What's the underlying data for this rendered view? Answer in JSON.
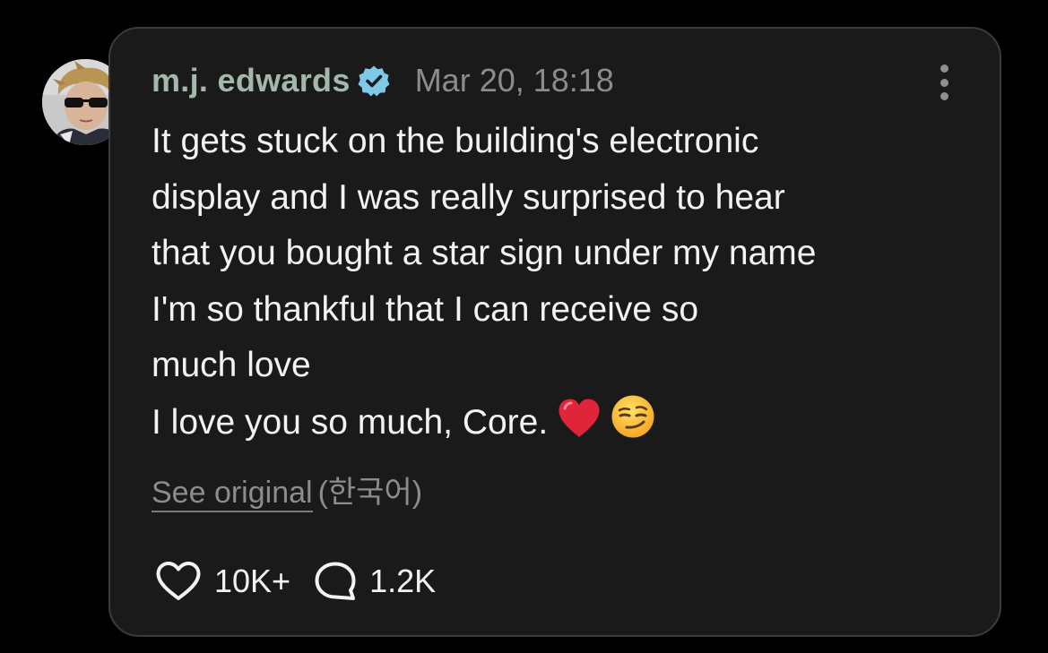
{
  "post": {
    "author": "m.j. edwards",
    "timestamp": "Mar 20, 18:18",
    "body_lines": [
      "It gets stuck on the building's electronic",
      "display and I was really surprised to hear",
      "that you bought a star sign under my name",
      "I'm so thankful that I can receive so",
      "much love",
      "I love you so much, Core."
    ],
    "see_original_label": "See original",
    "original_language": "(한국어)",
    "likes_count": "10K+",
    "comments_count": "1.2K"
  },
  "icons": {
    "verified": "verified-badge-icon",
    "more": "more-vertical-icon",
    "like": "heart-outline-icon",
    "comment": "speech-bubble-icon",
    "emoji_1": "red-heart-emoji",
    "emoji_2": "smirking-face-emoji"
  },
  "colors": {
    "background": "#000000",
    "card": "#1a1a1a",
    "card_border": "#3b3b3b",
    "author": "#a3b8ab",
    "verified_badge": "#7ec8e8",
    "text": "#f2f2f2",
    "muted": "#8c8c8c"
  }
}
